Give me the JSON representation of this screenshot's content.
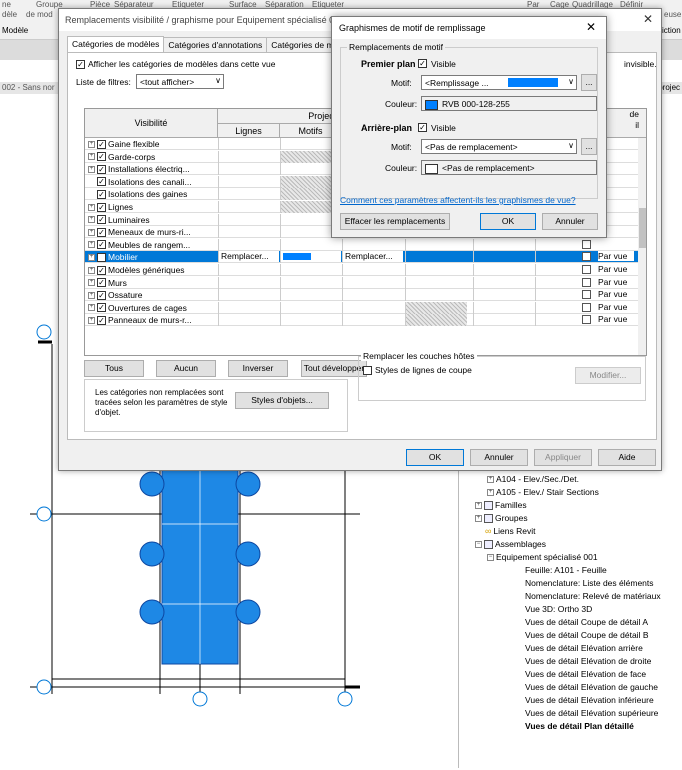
{
  "ribbon": {
    "items": [
      "ne",
      "Groupe",
      "Pièce",
      "Séparateur",
      "Etiqueter",
      "Surface",
      "Séparation",
      "Etiqueter",
      "Par",
      "Cage",
      "Quadrillage",
      "Définir"
    ],
    "row2": [
      "dèle",
      "de mod",
      "Modèle"
    ],
    "right": [
      "euse",
      "iction"
    ]
  },
  "view_tabs": {
    "left": "002 - Sans nor",
    "right": ".projec"
  },
  "browser": {
    "items": [
      {
        "label": "A104 - Elev./Sec./Det.",
        "icon": "plus"
      },
      {
        "label": "A105 - Elev./ Stair Sections",
        "icon": "plus"
      },
      {
        "label": "Familles",
        "icon": "plus-folder"
      },
      {
        "label": "Groupes",
        "icon": "plus-folder"
      },
      {
        "label": "Liens Revit",
        "icon": "link"
      },
      {
        "label": "Assemblages",
        "icon": "minus-folder"
      },
      {
        "label": "Equipement spécialisé 001",
        "icon": "minus"
      },
      {
        "label": "Feuille: A101 - Feuille"
      },
      {
        "label": "Nomenclature: Liste des éléments"
      },
      {
        "label": "Nomenclature: Relevé de matériaux"
      },
      {
        "label": "Vue 3D: Ortho 3D"
      },
      {
        "label": "Vues de détail Coupe de détail A"
      },
      {
        "label": "Vues de détail Coupe de détail B"
      },
      {
        "label": "Vues de détail Elévation arrière"
      },
      {
        "label": "Vues de détail Elévation de droite"
      },
      {
        "label": "Vues de détail Elévation de face"
      },
      {
        "label": "Vues de détail Elévation de gauche"
      },
      {
        "label": "Vues de détail Elévation inférieure"
      },
      {
        "label": "Vues de détail Elévation supérieure"
      },
      {
        "label": "Vues de détail Plan détaillé",
        "bold": true
      }
    ]
  },
  "dialog": {
    "title": "Remplacements visibilité / graphisme pour Equipement spécialisé 001",
    "tabs": [
      "Catégories de modèles",
      "Catégories d'annotations",
      "Catégories de mo"
    ],
    "show_model_label": "Afficher les catégories de modèles dans cette vue",
    "invisible_note": "invisible.",
    "filter_label": "Liste de filtres:",
    "filter_value": "<tout afficher>",
    "headers": {
      "visibility": "Visibilité",
      "projection": "Projection/Surface",
      "lines": "Lignes",
      "patterns": "Motifs",
      "detail_short": "de",
      "detail_short2": "il"
    },
    "rows": [
      {
        "name": "Gaine flexible",
        "expand": true,
        "detail": ""
      },
      {
        "name": "Garde-corps",
        "expand": true,
        "detail": ""
      },
      {
        "name": "Installations électriq...",
        "expand": true,
        "detail": ""
      },
      {
        "name": "Isolations des canali...",
        "expand": false,
        "detail": ""
      },
      {
        "name": "Isolations des gaines",
        "expand": false,
        "detail": ""
      },
      {
        "name": "Lignes",
        "expand": true,
        "detail": ""
      },
      {
        "name": "Luminaires",
        "expand": true,
        "detail": ""
      },
      {
        "name": "Meneaux de murs-ri...",
        "expand": true,
        "detail": ""
      },
      {
        "name": "Meubles de rangem...",
        "expand": true,
        "detail": ""
      },
      {
        "name": "Mobilier",
        "expand": true,
        "detail": "Par vue",
        "selected": true
      },
      {
        "name": "Modèles génériques",
        "expand": true,
        "detail": "Par vue"
      },
      {
        "name": "Murs",
        "expand": true,
        "detail": "Par vue"
      },
      {
        "name": "Ossature",
        "expand": true,
        "detail": "Par vue"
      },
      {
        "name": "Ouvertures de cages",
        "expand": true,
        "detail": "Par vue"
      },
      {
        "name": "Panneaux de murs-r...",
        "expand": true,
        "detail": "Par vue"
      }
    ],
    "replace_label": "Remplacer...",
    "buttons": {
      "all": "Tous",
      "none": "Aucun",
      "invert": "Inverser",
      "expand_all": "Tout développer",
      "object_styles": "Styles d'objets...",
      "modify": "Modifier...",
      "ok": "OK",
      "cancel": "Annuler",
      "apply": "Appliquer",
      "help": "Aide"
    },
    "note": "Les catégories non remplacées sont tracées selon les paramètres de style d'objet.",
    "host_group": "Remplacer les couches hôtes",
    "host_cut_label": "Styles de lignes de coupe"
  },
  "subdialog": {
    "title": "Graphismes de motif de remplissage",
    "group": "Remplacements de motif",
    "foreground": "Premier plan",
    "background": "Arrière-plan",
    "visible": "Visible",
    "pattern_label": "Motif:",
    "color_label": "Couleur:",
    "fg_pattern": "<Remplissage ...",
    "fg_color": "RVB 000-128-255",
    "bg_pattern": "<Pas de remplacement>",
    "bg_color": "<Pas de remplacement>",
    "link": "Comment ces paramètres affectent-ils les graphismes de vue?",
    "clear": "Effacer les remplacements",
    "ok": "OK",
    "cancel": "Annuler",
    "more": "..."
  },
  "colors": {
    "fill": "#0080ff",
    "select": "#0078d7"
  }
}
